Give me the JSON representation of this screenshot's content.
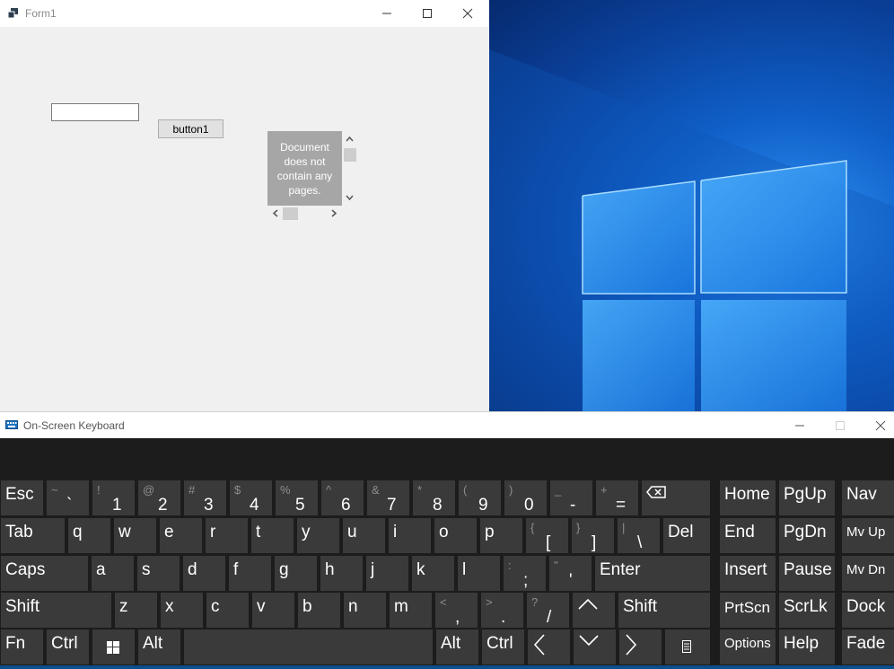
{
  "form1": {
    "title": "Form1",
    "textbox_value": "",
    "button_label": "button1",
    "viewer_message": "Document does not contain any pages."
  },
  "osk": {
    "title": "On-Screen Keyboard",
    "keys": {
      "esc": "Esc",
      "grave": {
        "shift": "~",
        "main": "`"
      },
      "d1": {
        "shift": "!",
        "main": "1"
      },
      "d2": {
        "shift": "@",
        "main": "2"
      },
      "d3": {
        "shift": "#",
        "main": "3"
      },
      "d4": {
        "shift": "$",
        "main": "4"
      },
      "d5": {
        "shift": "%",
        "main": "5"
      },
      "d6": {
        "shift": "^",
        "main": "6"
      },
      "d7": {
        "shift": "&",
        "main": "7"
      },
      "d8": {
        "shift": "*",
        "main": "8"
      },
      "d9": {
        "shift": "(",
        "main": "9"
      },
      "d0": {
        "shift": ")",
        "main": "0"
      },
      "minus": {
        "shift": "_",
        "main": "-"
      },
      "equals": {
        "shift": "+",
        "main": "="
      },
      "tab": "Tab",
      "q": "q",
      "w": "w",
      "e": "e",
      "r": "r",
      "t": "t",
      "y": "y",
      "u": "u",
      "i": "i",
      "o": "o",
      "p": "p",
      "lbracket": {
        "shift": "{",
        "main": "["
      },
      "rbracket": {
        "shift": "}",
        "main": "]"
      },
      "backslash": {
        "shift": "|",
        "main": "\\"
      },
      "del": "Del",
      "caps": "Caps",
      "a": "a",
      "s": "s",
      "d": "d",
      "f": "f",
      "g": "g",
      "h": "h",
      "j": "j",
      "k": "k",
      "l": "l",
      "semicolon": {
        "shift": ":",
        "main": ";"
      },
      "quote": {
        "shift": "\"",
        "main": "'"
      },
      "enter": "Enter",
      "shift_left": "Shift",
      "z": "z",
      "x": "x",
      "c": "c",
      "v": "v",
      "b": "b",
      "n": "n",
      "m": "m",
      "comma": {
        "shift": "<",
        "main": ","
      },
      "period": {
        "shift": ">",
        "main": "."
      },
      "slash": {
        "shift": "?",
        "main": "/"
      },
      "shift_right": "Shift",
      "fn": "Fn",
      "ctrl_left": "Ctrl",
      "alt_left": "Alt",
      "alt_right": "Alt",
      "ctrl_right": "Ctrl",
      "home": "Home",
      "pgup": "PgUp",
      "nav": "Nav",
      "end": "End",
      "pgdn": "PgDn",
      "mvup": "Mv Up",
      "insert": "Insert",
      "pause": "Pause",
      "mvdn": "Mv Dn",
      "prtscn": "PrtScn",
      "scrlk": "ScrLk",
      "dock": "Dock",
      "options": "Options",
      "help": "Help",
      "fade": "Fade"
    }
  },
  "colors": {
    "key_bg": "#3a3a3a",
    "osk_bg": "#1c1c1c",
    "form_bg": "#f0f0f0"
  }
}
